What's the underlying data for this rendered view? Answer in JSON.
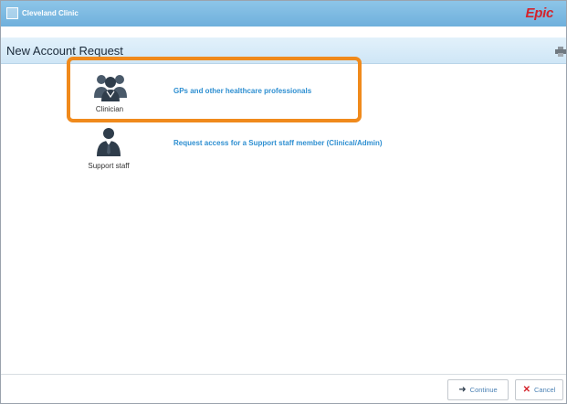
{
  "header": {
    "brand_name": "Cleveland Clinic",
    "product_name": "Epic",
    "brand_color": "#7cb9e2",
    "epic_color": "#d4232b"
  },
  "page": {
    "title": "New Account Request",
    "print_icon": "printer-icon"
  },
  "options": [
    {
      "icon": "clinician-group-icon",
      "caption": "Clinician",
      "link": "GPs and other healthcare professionals"
    },
    {
      "icon": "support-staff-icon",
      "caption": "Support staff",
      "link": "Request access for a Support staff member (Clinical/Admin)"
    }
  ],
  "highlight_color": "#f08a1c",
  "footer": {
    "continue_label": "Continue",
    "continue_icon": "arrow-right-icon",
    "cancel_label": "Cancel",
    "cancel_icon": "close-icon"
  }
}
